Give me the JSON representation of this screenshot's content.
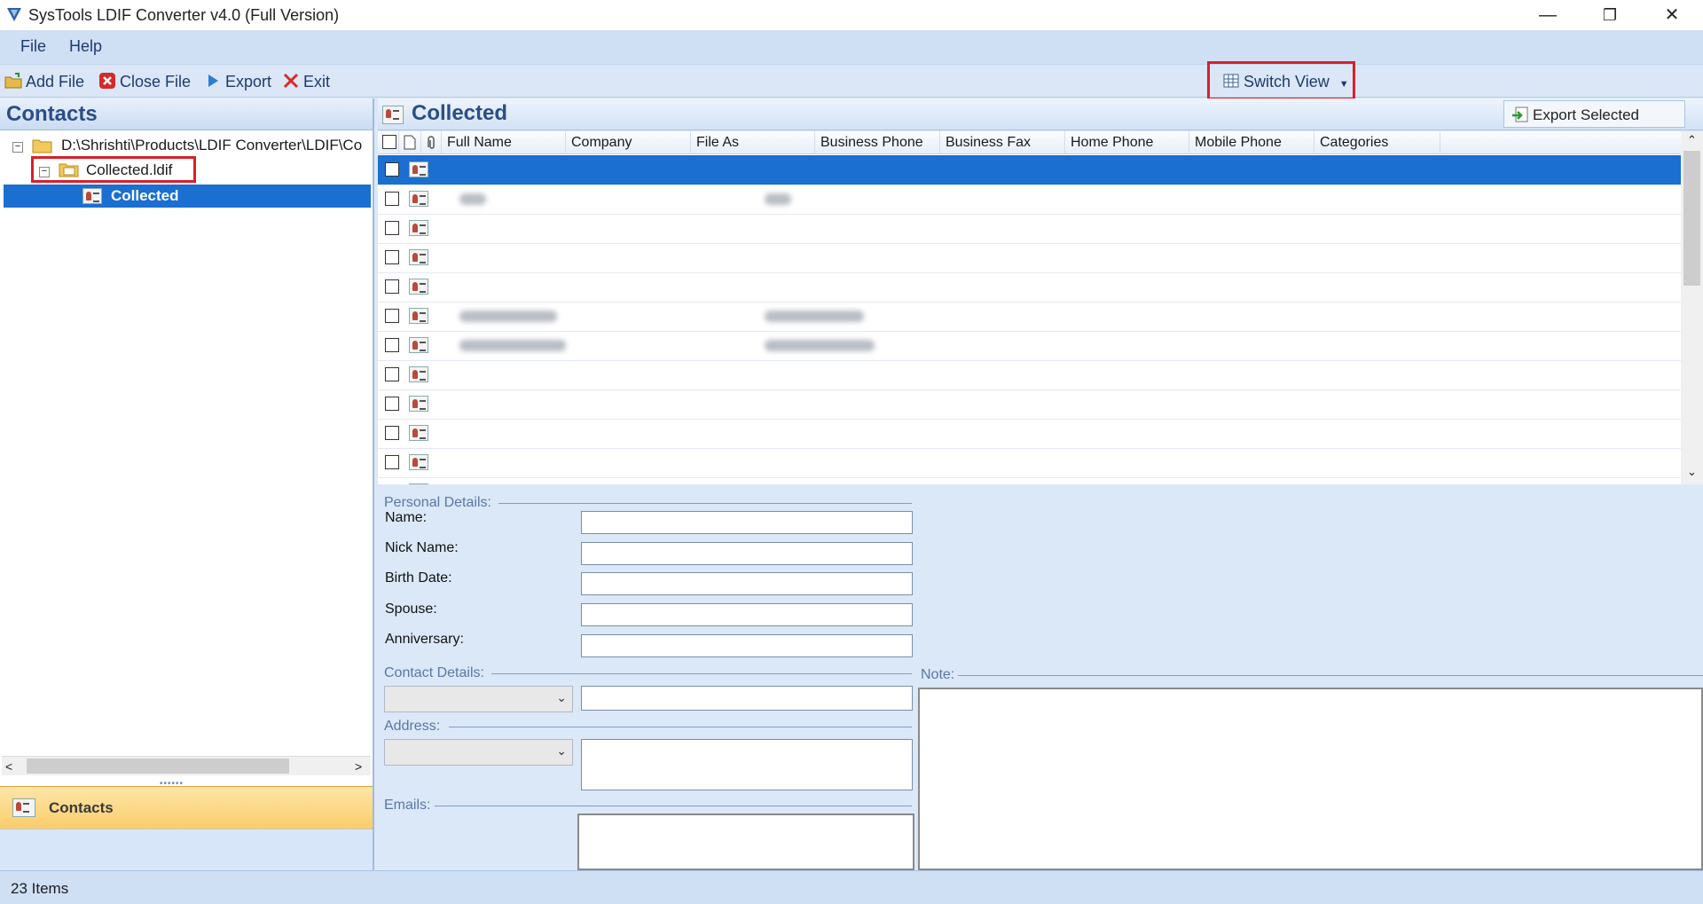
{
  "window": {
    "title": "SysTools LDIF Converter v4.0 (Full Version)",
    "minimize": "—",
    "restore": "❐",
    "close": "✕"
  },
  "menu": {
    "file": "File",
    "help": "Help"
  },
  "toolbar": {
    "add_file": "Add File",
    "close_file": "Close File",
    "export": "Export",
    "exit": "Exit",
    "switch_view": "Switch View"
  },
  "left_pane": {
    "title": "Contacts",
    "tree": {
      "root_path": "D:\\Shrishti\\Products\\LDIF Converter\\LDIF\\Co",
      "file": "Collected.ldif",
      "folder": "Collected"
    },
    "bottom_tab": "Contacts"
  },
  "grid": {
    "title": "Collected",
    "export_selected": "Export Selected",
    "columns": [
      "Full Name",
      "Company",
      "File As",
      "Business Phone",
      "Business Fax",
      "Home Phone",
      "Mobile Phone",
      "Categories"
    ]
  },
  "details": {
    "personal_section": "Personal Details:",
    "name_label": "Name:",
    "nick_label": "Nick Name:",
    "birth_label": "Birth Date:",
    "spouse_label": "Spouse:",
    "anniversary_label": "Anniversary:",
    "contact_section": "Contact Details:",
    "note_section": "Note:",
    "address_section": "Address:",
    "emails_section": "Emails:"
  },
  "status": {
    "items": "23 Items"
  },
  "colors": {
    "accent": "#1a6fd1",
    "highlight_box": "#d8202a"
  }
}
